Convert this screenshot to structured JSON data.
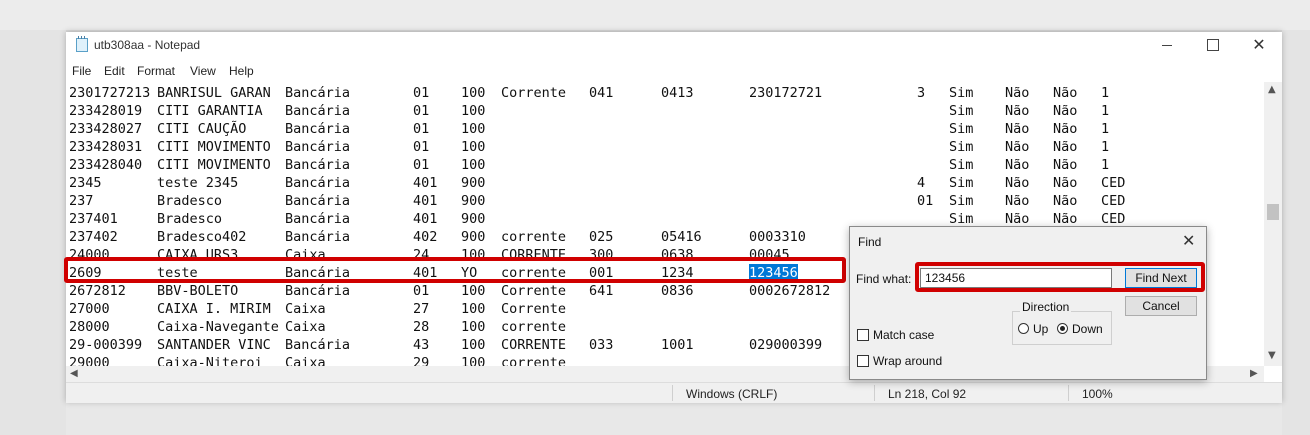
{
  "window": {
    "title": "utb308aa - Notepad",
    "close_glyph": "✕"
  },
  "menu": [
    "File",
    "Edit",
    "Format",
    "View",
    "Help"
  ],
  "rows": [
    [
      "2301727213",
      "BANRISUL GARAN",
      "Bancária",
      "01",
      "100",
      "Corrente",
      "041",
      "0413",
      "230172721",
      "3",
      "Sim",
      "Não",
      "Não",
      "1"
    ],
    [
      "233428019",
      "CITI GARANTIA",
      "Bancária",
      "01",
      "100",
      "",
      "",
      "",
      "",
      "",
      "Sim",
      "Não",
      "Não",
      "1"
    ],
    [
      "233428027",
      "CITI CAUÇÃO",
      "Bancária",
      "01",
      "100",
      "",
      "",
      "",
      "",
      "",
      "Sim",
      "Não",
      "Não",
      "1"
    ],
    [
      "233428031",
      "CITI MOVIMENTO",
      "Bancária",
      "01",
      "100",
      "",
      "",
      "",
      "",
      "",
      "Sim",
      "Não",
      "Não",
      "1"
    ],
    [
      "233428040",
      "CITI MOVIMENTO",
      "Bancária",
      "01",
      "100",
      "",
      "",
      "",
      "",
      "",
      "Sim",
      "Não",
      "Não",
      "1"
    ],
    [
      "2345",
      "teste 2345",
      "Bancária",
      "401",
      "900",
      "",
      "",
      "",
      "",
      "4",
      "Sim",
      "Não",
      "Não",
      "CED"
    ],
    [
      "237",
      "Bradesco",
      "Bancária",
      "401",
      "900",
      "",
      "",
      "",
      "",
      "01",
      "Sim",
      "Não",
      "Não",
      "CED"
    ],
    [
      "237401",
      "Bradesco",
      "Bancária",
      "401",
      "900",
      "",
      "",
      "",
      "",
      "",
      "Sim",
      "Não",
      "Não",
      "CED"
    ],
    [
      "237402",
      "Bradesco402",
      "Bancária",
      "402",
      "900",
      "corrente",
      "025",
      "05416",
      "0003310",
      "",
      "",
      "",
      "",
      ""
    ],
    [
      "24000",
      "CAIXA URS3",
      "Caixa",
      "24",
      "100",
      "CORRENTE",
      "300",
      "0638",
      "00045",
      "",
      "",
      "",
      "",
      ""
    ],
    [
      "2609",
      "teste",
      "Bancária",
      "401",
      "YO",
      "corrente",
      "001",
      "1234",
      "123456",
      "",
      "",
      "",
      "",
      ""
    ],
    [
      "2672812",
      "BBV-BOLETO",
      "Bancária",
      "01",
      "100",
      "Corrente",
      "641",
      "0836",
      "0002672812",
      "",
      "",
      "",
      "",
      ""
    ],
    [
      "27000",
      "CAIXA I. MIRIM",
      "Caixa",
      "27",
      "100",
      "Corrente",
      "",
      "",
      "",
      "",
      "",
      "",
      "",
      ""
    ],
    [
      "28000",
      "Caixa-Navegante",
      "Caixa",
      "28",
      "100",
      "corrente",
      "",
      "",
      "",
      "",
      "",
      "",
      "",
      ""
    ],
    [
      "29-000399",
      "SANTANDER VINC",
      "Bancária",
      "43",
      "100",
      "CORRENTE",
      "033",
      "1001",
      "029000399",
      "",
      "",
      "",
      "",
      ""
    ],
    [
      "29000",
      "Caixa-Niteroi",
      "Caixa",
      "29",
      "100",
      "corrente",
      "",
      "",
      "",
      "",
      "",
      "",
      "",
      ""
    ]
  ],
  "status": {
    "line_ending": "Windows (CRLF)",
    "position": "Ln 218, Col 92",
    "zoom": "100%"
  },
  "find": {
    "title": "Find",
    "find_what_label": "Find what:",
    "find_what_value": "123456",
    "find_next_label": "Find Next",
    "cancel_label": "Cancel",
    "direction_label": "Direction",
    "up_label": "Up",
    "down_label": "Down",
    "direction_selected": "Down",
    "match_case_label": "Match case",
    "match_case_checked": false,
    "wrap_around_label": "Wrap around",
    "wrap_around_checked": false
  },
  "colors": {
    "highlight_border": "#d00000",
    "selection": "#0078d7"
  }
}
